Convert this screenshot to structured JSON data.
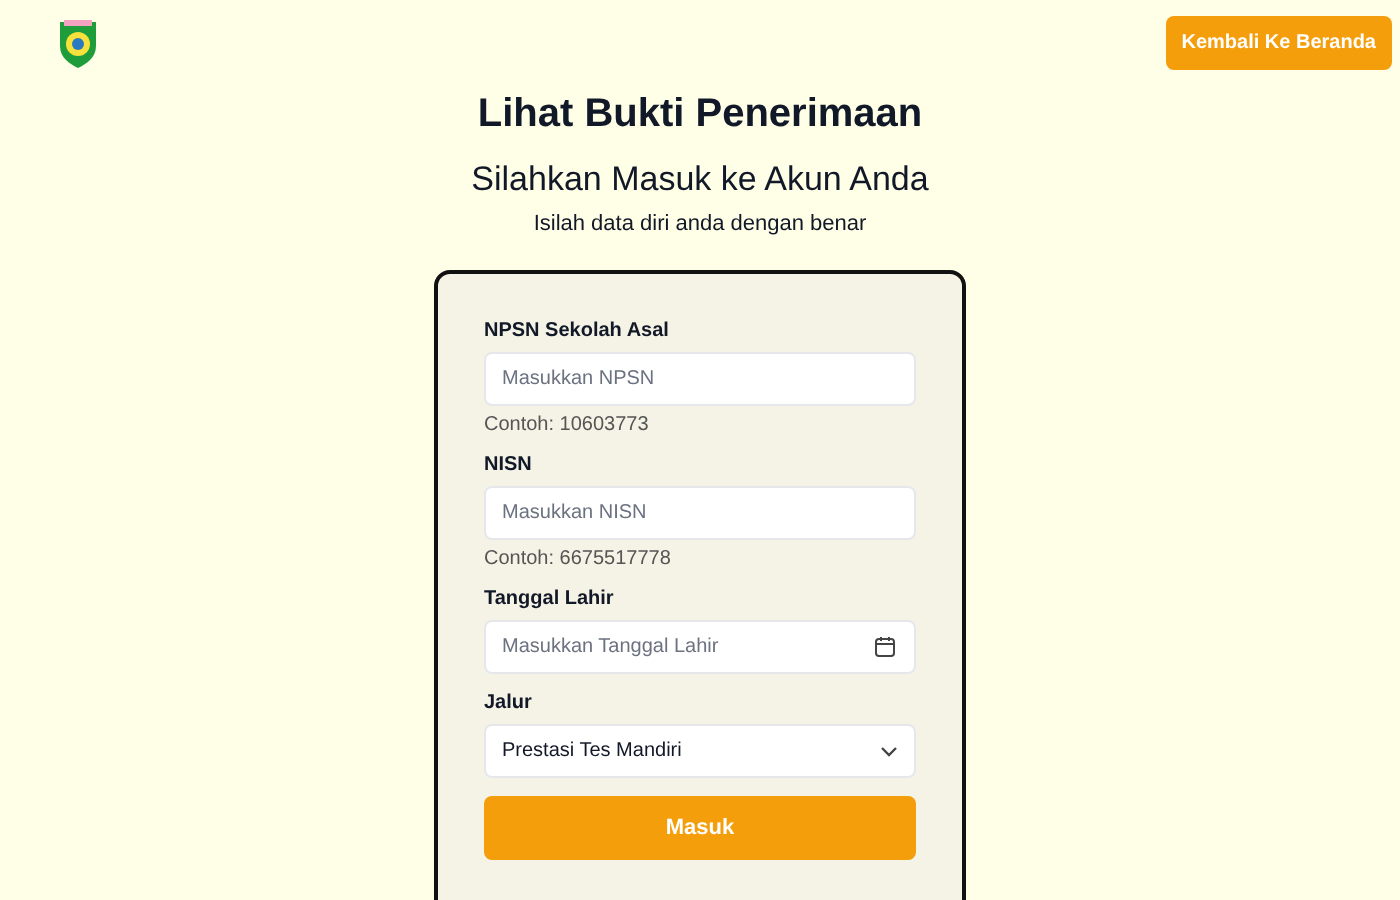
{
  "header": {
    "home_button": "Kembali Ke Beranda"
  },
  "title": "Lihat Bukti Penerimaan",
  "subtitle": "Silahkan Masuk ke Akun Anda",
  "instruction": "Isilah data diri anda dengan benar",
  "form": {
    "fields": [
      {
        "kind": "text",
        "label": "NPSN Sekolah Asal",
        "placeholder": "Masukkan NPSN",
        "hint": "Contoh: 10603773"
      },
      {
        "kind": "text",
        "label": "NISN",
        "placeholder": "Masukkan NISN",
        "hint": "Contoh: 6675517778"
      },
      {
        "kind": "date",
        "label": "Tanggal Lahir",
        "placeholder": "Masukkan Tanggal Lahir"
      },
      {
        "kind": "select",
        "label": "Jalur",
        "value": "Prestasi Tes Mandiri"
      }
    ],
    "submit": "Masuk"
  }
}
